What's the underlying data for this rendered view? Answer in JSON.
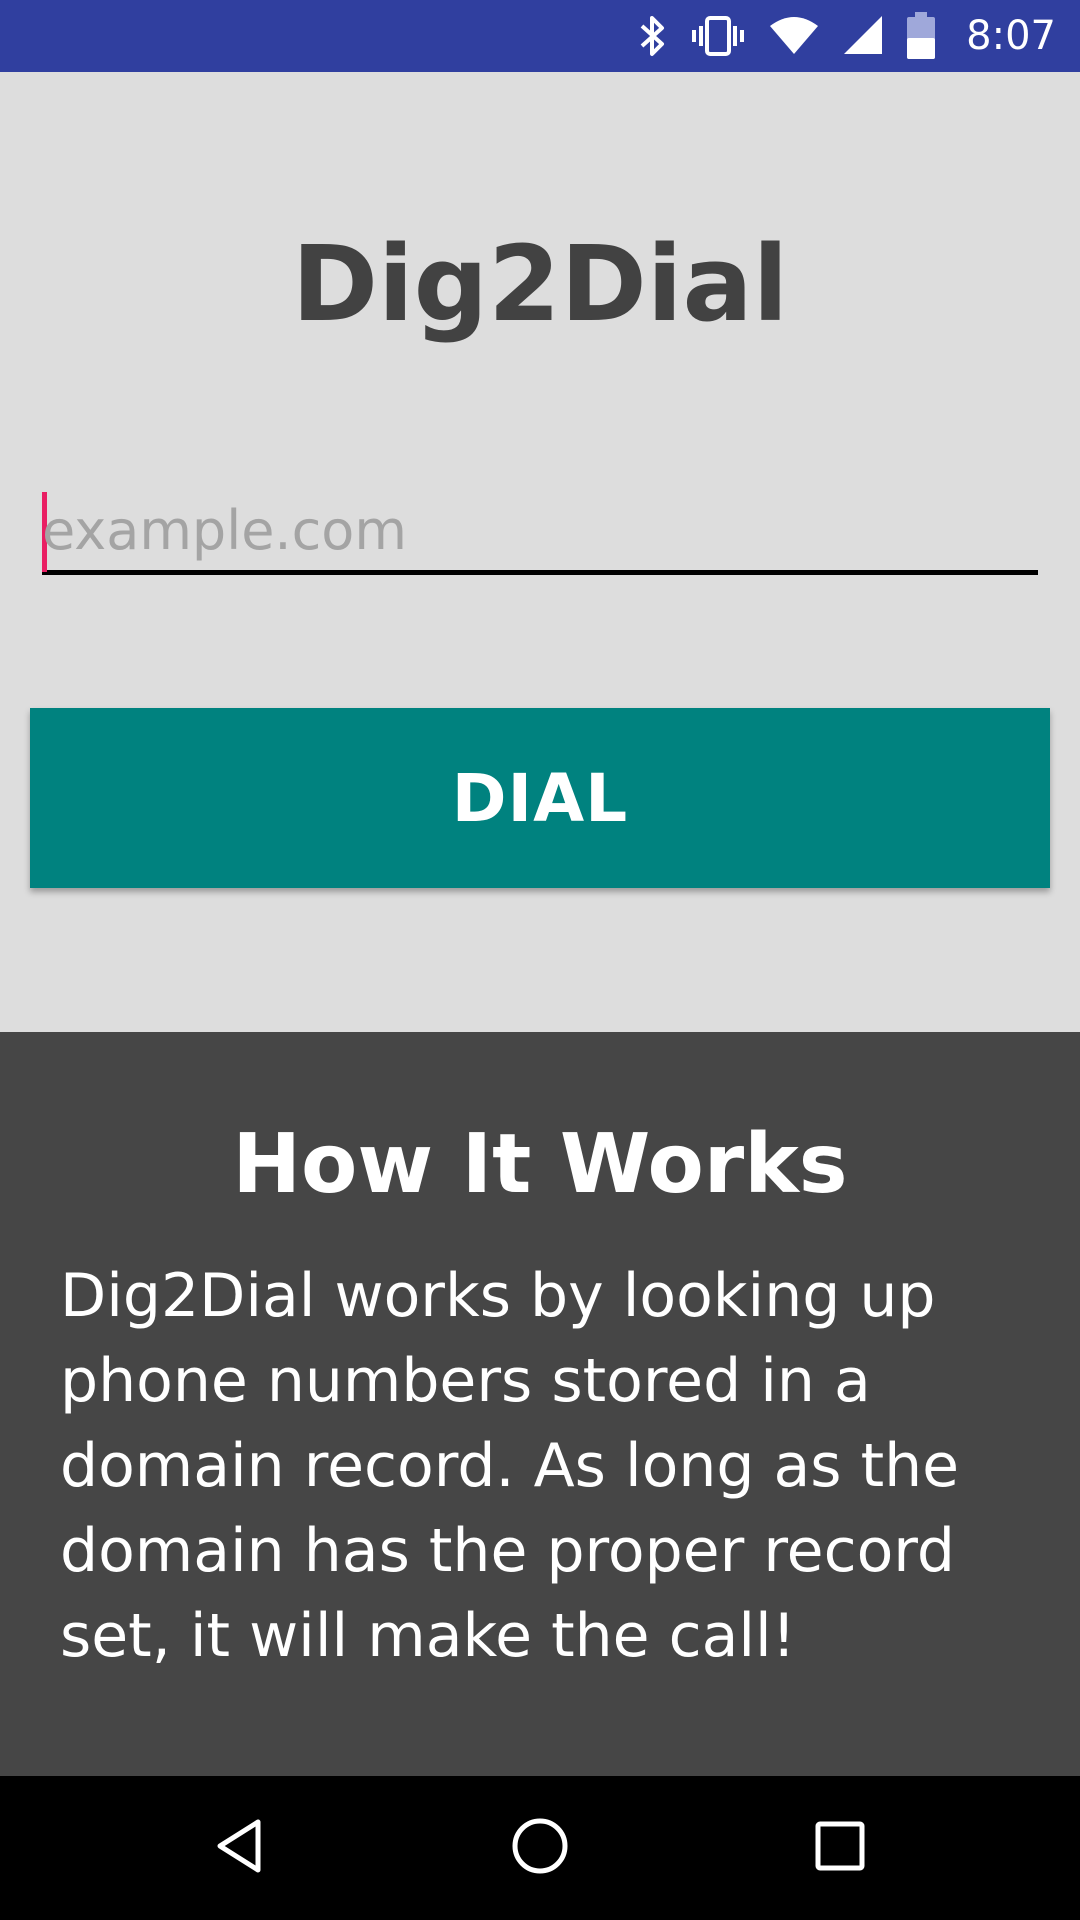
{
  "status_bar": {
    "time": "8:07",
    "icons": [
      "bluetooth-icon",
      "vibrate-icon",
      "wifi-icon",
      "cell-signal-icon",
      "battery-icon"
    ]
  },
  "app": {
    "title": "Dig2Dial"
  },
  "domain_input": {
    "value": "",
    "placeholder": "example.com"
  },
  "dial_button": {
    "label": "DIAL",
    "color": "#00827f"
  },
  "how_it_works": {
    "title": "How It Works",
    "body": "Dig2Dial works by looking up phone numbers stored in a domain record. As long as the domain has the proper record set, it will make the call!"
  },
  "nav_bar": {
    "icons": [
      "back-icon",
      "home-icon",
      "recents-icon"
    ]
  },
  "colors": {
    "status_bar": "#303f9f",
    "background": "#dddddd",
    "info_background": "#464646",
    "cursor": "#e91e63"
  }
}
